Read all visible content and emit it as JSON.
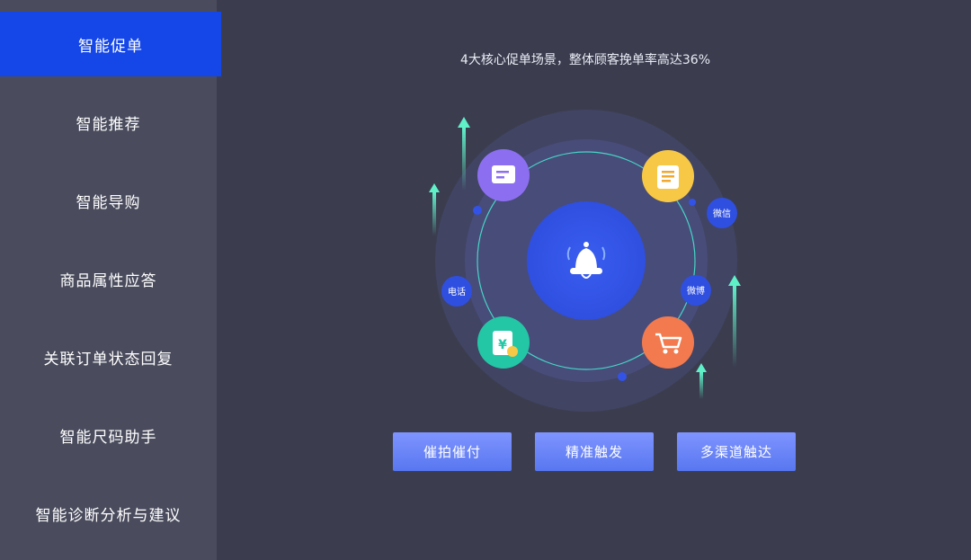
{
  "sidebar": {
    "items": [
      {
        "label": "智能促单",
        "active": true
      },
      {
        "label": "智能推荐",
        "active": false
      },
      {
        "label": "智能导购",
        "active": false
      },
      {
        "label": "商品属性应答",
        "active": false
      },
      {
        "label": "关联订单状态回复",
        "active": false
      },
      {
        "label": "智能尺码助手",
        "active": false
      },
      {
        "label": "智能诊断分析与建议",
        "active": false
      }
    ]
  },
  "main": {
    "headline": "4大核心促单场景，整体顾客挽单率高达36%"
  },
  "diagram": {
    "center_icon": "bell-icon",
    "channels": {
      "phone": "电话",
      "wechat": "微信",
      "weibo": "微博"
    },
    "scenario_icons": [
      "chat-card-icon",
      "shop-badge-icon",
      "payment-yen-icon",
      "shopping-cart-icon"
    ]
  },
  "buttons": {
    "urge": "催拍催付",
    "precise": "精准触发",
    "multichannel": "多渠道触达"
  },
  "colors": {
    "accent": "#1446e8",
    "sidebar_bg": "#4a4c5e",
    "page_bg": "#3b3d4f",
    "button": "#6f88fa"
  }
}
